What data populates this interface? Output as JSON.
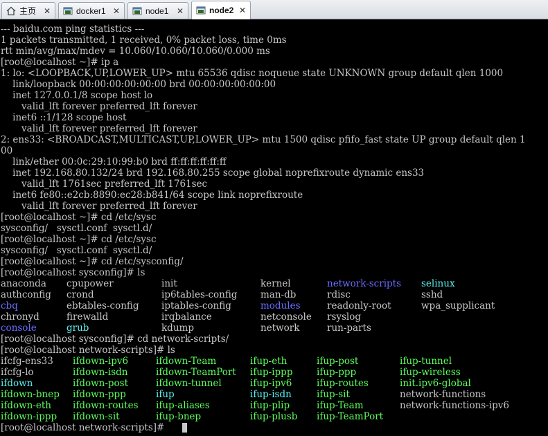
{
  "tabs": [
    {
      "label": "主页",
      "icon": "home-icon",
      "active": false
    },
    {
      "label": "docker1",
      "icon": "terminal-icon",
      "active": false
    },
    {
      "label": "node1",
      "icon": "terminal-icon",
      "active": false
    },
    {
      "label": "node2",
      "icon": "terminal-icon",
      "active": true
    }
  ],
  "terminal": {
    "lines": [
      "--- baidu.com ping statistics ---",
      "1 packets transmitted, 1 received, 0% packet loss, time 0ms",
      "rtt min/avg/max/mdev = 10.060/10.060/10.060/0.000 ms",
      "[root@localhost ~]# ip a",
      "1: lo: <LOOPBACK,UP,LOWER_UP> mtu 65536 qdisc noqueue state UNKNOWN group default qlen 1000",
      "    link/loopback 00:00:00:00:00:00 brd 00:00:00:00:00:00",
      "    inet 127.0.0.1/8 scope host lo",
      "       valid_lft forever preferred_lft forever",
      "    inet6 ::1/128 scope host",
      "       valid_lft forever preferred_lft forever",
      "2: ens33: <BROADCAST,MULTICAST,UP,LOWER_UP> mtu 1500 qdisc pfifo_fast state UP group default qlen 1",
      "00",
      "    link/ether 00:0c:29:10:99:b0 brd ff:ff:ff:ff:ff:ff",
      "    inet 192.168.80.132/24 brd 192.168.80.255 scope global noprefixroute dynamic ens33",
      "       valid_lft 1761sec preferred_lft 1761sec",
      "    inet6 fe80::e2cb:8890:ec28:b841/64 scope link noprefixroute",
      "       valid_lft forever preferred_lft forever",
      "[root@localhost ~]# cd /etc/sysc",
      "sysconfig/   sysctl.conf  sysctl.d/",
      "[root@localhost ~]# cd /etc/sysc",
      "sysconfig/   sysctl.conf  sysctl.d/",
      "[root@localhost ~]# cd /etc/sysconfig/",
      "[root@localhost sysconfig]# ls"
    ],
    "ls_sysconfig": [
      [
        {
          "t": "anaconda",
          "c": "file"
        },
        {
          "t": "cpupower",
          "c": "file"
        },
        {
          "t": "init",
          "c": "file"
        },
        {
          "t": "kernel",
          "c": "file"
        },
        {
          "t": "network-scripts",
          "c": "dir"
        },
        {
          "t": "selinux",
          "c": "cyan"
        }
      ],
      [
        {
          "t": "authconfig",
          "c": "file"
        },
        {
          "t": "crond",
          "c": "file"
        },
        {
          "t": "ip6tables-config",
          "c": "file"
        },
        {
          "t": "man-db",
          "c": "file"
        },
        {
          "t": "rdisc",
          "c": "file"
        },
        {
          "t": "sshd",
          "c": "file"
        }
      ],
      [
        {
          "t": "cbq",
          "c": "dir"
        },
        {
          "t": "ebtables-config",
          "c": "file"
        },
        {
          "t": "iptables-config",
          "c": "file"
        },
        {
          "t": "modules",
          "c": "dir"
        },
        {
          "t": "readonly-root",
          "c": "file"
        },
        {
          "t": "wpa_supplicant",
          "c": "file"
        }
      ],
      [
        {
          "t": "chronyd",
          "c": "file"
        },
        {
          "t": "firewalld",
          "c": "file"
        },
        {
          "t": "irqbalance",
          "c": "file"
        },
        {
          "t": "netconsole",
          "c": "file"
        },
        {
          "t": "rsyslog",
          "c": "file"
        },
        {
          "t": "",
          "c": "file"
        }
      ],
      [
        {
          "t": "console",
          "c": "dir"
        },
        {
          "t": "grub",
          "c": "cyan"
        },
        {
          "t": "kdump",
          "c": "file"
        },
        {
          "t": "network",
          "c": "file"
        },
        {
          "t": "run-parts",
          "c": "file"
        },
        {
          "t": "",
          "c": "file"
        }
      ]
    ],
    "mid_lines": [
      "[root@localhost sysconfig]# cd network-scripts/",
      "[root@localhost network-scripts]# ls"
    ],
    "ls_network_scripts": [
      [
        {
          "t": "ifcfg-ens33",
          "c": "file"
        },
        {
          "t": "ifdown-ipv6",
          "c": "green"
        },
        {
          "t": "ifdown-Team",
          "c": "green"
        },
        {
          "t": "ifup-eth",
          "c": "green"
        },
        {
          "t": "ifup-post",
          "c": "green"
        },
        {
          "t": "ifup-tunnel",
          "c": "green"
        }
      ],
      [
        {
          "t": "ifcfg-lo",
          "c": "file"
        },
        {
          "t": "ifdown-isdn",
          "c": "green"
        },
        {
          "t": "ifdown-TeamPort",
          "c": "green"
        },
        {
          "t": "ifup-ippp",
          "c": "green"
        },
        {
          "t": "ifup-ppp",
          "c": "green"
        },
        {
          "t": "ifup-wireless",
          "c": "green"
        }
      ],
      [
        {
          "t": "ifdown",
          "c": "cyan"
        },
        {
          "t": "ifdown-post",
          "c": "green"
        },
        {
          "t": "ifdown-tunnel",
          "c": "green"
        },
        {
          "t": "ifup-ipv6",
          "c": "green"
        },
        {
          "t": "ifup-routes",
          "c": "green"
        },
        {
          "t": "init.ipv6-global",
          "c": "green"
        }
      ],
      [
        {
          "t": "ifdown-bnep",
          "c": "green"
        },
        {
          "t": "ifdown-ppp",
          "c": "green"
        },
        {
          "t": "ifup",
          "c": "cyan"
        },
        {
          "t": "ifup-isdn",
          "c": "cyan"
        },
        {
          "t": "ifup-sit",
          "c": "green"
        },
        {
          "t": "network-functions",
          "c": "file"
        }
      ],
      [
        {
          "t": "ifdown-eth",
          "c": "green"
        },
        {
          "t": "ifdown-routes",
          "c": "green"
        },
        {
          "t": "ifup-aliases",
          "c": "green"
        },
        {
          "t": "ifup-plip",
          "c": "green"
        },
        {
          "t": "ifup-Team",
          "c": "green"
        },
        {
          "t": "network-functions-ipv6",
          "c": "file"
        }
      ],
      [
        {
          "t": "ifdown-ippp",
          "c": "green"
        },
        {
          "t": "ifdown-sit",
          "c": "green"
        },
        {
          "t": "ifup-bnep",
          "c": "green"
        },
        {
          "t": "ifup-plusb",
          "c": "green"
        },
        {
          "t": "ifup-TeamPort",
          "c": "green"
        },
        {
          "t": "",
          "c": "file"
        }
      ]
    ],
    "prompt": "[root@localhost network-scripts]# ",
    "colors": {
      "fg": "#c7c7c7",
      "dir": "#6b6bff",
      "cyan": "#5ff0f0",
      "green": "#5cff5c",
      "bg": "#000000"
    }
  }
}
